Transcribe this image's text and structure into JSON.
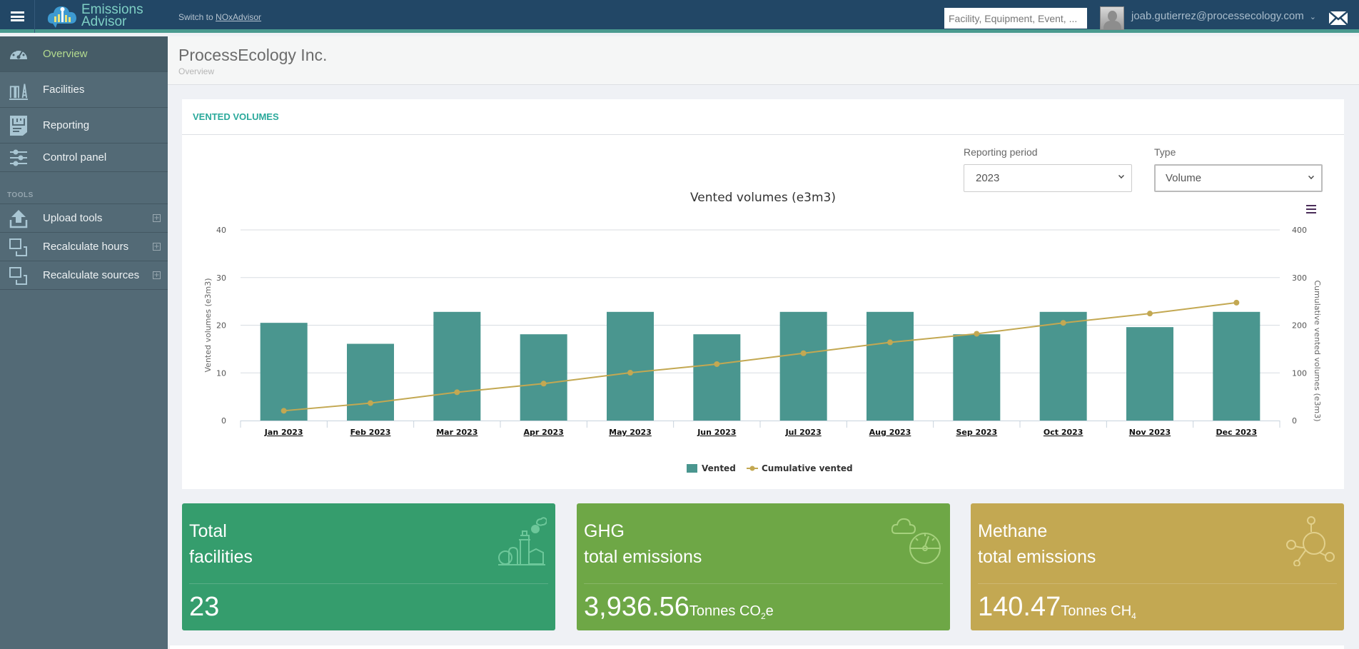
{
  "topbar": {
    "app_name_line1": "Emissions",
    "app_name_line2": "Advisor",
    "switch_prefix": "Switch to ",
    "switch_link": "NOxAdvisor",
    "search_placeholder": "Facility, Equipment, Event, ...",
    "user_email": "joab.gutierrez@processecology.com",
    "icons": [
      "hamburger-icon",
      "cloud-chart-logo",
      "avatar",
      "chevron-down-icon",
      "mail-icon"
    ]
  },
  "sidebar": {
    "items": [
      {
        "label": "Overview",
        "icon": "dashboard-gauge-icon",
        "active": true
      },
      {
        "label": "Facilities",
        "icon": "facilities-icon",
        "active": false
      },
      {
        "label": "Reporting",
        "icon": "report-icon",
        "active": false
      },
      {
        "label": "Control panel",
        "icon": "sliders-icon",
        "active": false
      }
    ],
    "section_label": "TOOLS",
    "tools": [
      {
        "label": "Upload tools",
        "icon": "upload-icon",
        "expand": "+"
      },
      {
        "label": "Recalculate hours",
        "icon": "recalculate-icon",
        "expand": "+"
      },
      {
        "label": "Recalculate sources",
        "icon": "recalculate-icon",
        "expand": "+"
      }
    ]
  },
  "page": {
    "title": "ProcessEcology Inc.",
    "breadcrumb": "Overview"
  },
  "vented_card": {
    "heading": "VENTED VOLUMES",
    "reporting_period_label": "Reporting period",
    "reporting_period_value": "2023",
    "type_label": "Type",
    "type_value": "Volume"
  },
  "chart_data": {
    "type": "bar",
    "title": "Vented volumes (e3m3)",
    "categories": [
      "Jan 2023",
      "Feb 2023",
      "Mar 2023",
      "Apr 2023",
      "May 2023",
      "Jun 2023",
      "Jul 2023",
      "Aug 2023",
      "Sep 2023",
      "Oct 2023",
      "Nov 2023",
      "Dec 2023"
    ],
    "series": [
      {
        "name": "Vented",
        "type": "bar",
        "axis": "left",
        "color": "#4a968f",
        "values": [
          20.5,
          16.1,
          22.8,
          18.1,
          22.8,
          18.1,
          22.8,
          22.8,
          18.1,
          22.8,
          19.6,
          22.8
        ]
      },
      {
        "name": "Cumulative vented",
        "type": "line",
        "axis": "right",
        "color": "#c3a852",
        "values": [
          20.5,
          36.6,
          59.4,
          77.5,
          100.3,
          118.4,
          141.2,
          164.0,
          182.1,
          204.9,
          224.5,
          247.3
        ]
      }
    ],
    "ylabel": "Vented volumes (e3m3)",
    "ylim": [
      0,
      40
    ],
    "yticks": [
      "0",
      "10",
      "20",
      "30",
      "40"
    ],
    "y2label": "Cumulative vented volumes (e3m3)",
    "y2lim": [
      0,
      400
    ],
    "y2ticks": [
      "0",
      "100",
      "200",
      "300",
      "400"
    ],
    "grid": true,
    "legend": "bottom-center"
  },
  "kpis": [
    {
      "title_line1": "Total",
      "title_line2": "facilities",
      "value": "23",
      "unit": "",
      "unit_sub": "",
      "unit_suffix": "",
      "color": "#359d6d",
      "icon": "facility-icon"
    },
    {
      "title_line1": "GHG",
      "title_line2": "total emissions",
      "value": "3,936.56",
      "unit": "Tonnes CO",
      "unit_sub": "2",
      "unit_suffix": "e",
      "color": "#6ea746",
      "icon": "cloud-gauge-icon"
    },
    {
      "title_line1": "Methane",
      "title_line2": "total emissions",
      "value": "140.47",
      "unit": "Tonnes CH",
      "unit_sub": "4",
      "unit_suffix": "",
      "color": "#c3a852",
      "icon": "molecule-icon"
    }
  ]
}
